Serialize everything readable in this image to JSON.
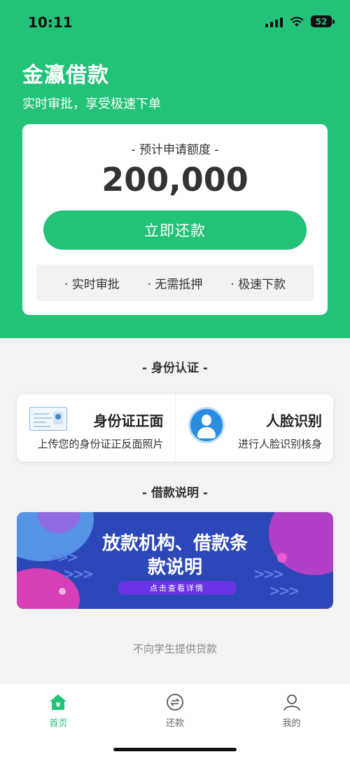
{
  "status_bar": {
    "time": "10:11",
    "battery": "52"
  },
  "header": {
    "title": "金瀛借款",
    "subtitle": "实时审批，享受极速下单"
  },
  "quota_card": {
    "label": "- 预计申请额度 -",
    "amount": "200,000",
    "button": "立即还款",
    "features": [
      "· 实时审批",
      "· 无需抵押",
      "· 极速下款"
    ]
  },
  "identity": {
    "section_title": "- 身份认证 -",
    "items": [
      {
        "title": "身份证正面",
        "desc": "上传您的身份证正反面照片",
        "icon": "id-card-icon"
      },
      {
        "title": "人脸识别",
        "desc": "进行人脸识别核身",
        "icon": "face-recognition-icon"
      }
    ]
  },
  "loan_info": {
    "section_title": "- 借款说明 -",
    "banner_title_line1": "放款机构、借款条",
    "banner_title_line2": "款说明",
    "banner_button": "点击查看详情"
  },
  "disclaimer": "不向学生提供贷款",
  "tabbar": {
    "items": [
      {
        "label": "首页",
        "icon": "home-icon",
        "active": true
      },
      {
        "label": "还款",
        "icon": "repay-icon",
        "active": false
      },
      {
        "label": "我的",
        "icon": "profile-icon",
        "active": false
      }
    ]
  },
  "colors": {
    "primary": "#22c278",
    "banner": "#2c47b8",
    "accent_purple": "#6a34e6"
  }
}
